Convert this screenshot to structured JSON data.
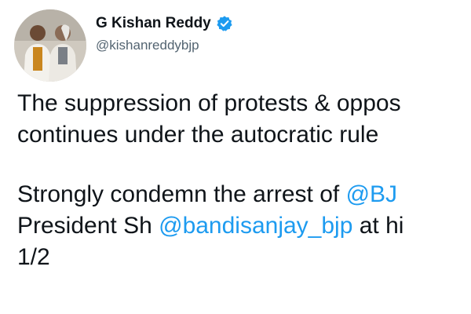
{
  "profile": {
    "display_name": "G Kishan Reddy",
    "handle": "@kishanreddybjp",
    "verified_icon": "verified-badge-icon",
    "verified_color": "#1d9bf0"
  },
  "tweet": {
    "line1": "The suppression of protests & oppos",
    "line2": "continues under the autocratic rule",
    "line3_prefix": "Strongly condemn the arrest of ",
    "line3_mention": "@BJ",
    "line4_prefix": "President Sh ",
    "line4_mention": "@bandisanjay_bjp",
    "line4_suffix": " at hi",
    "line5": "1/2"
  },
  "colors": {
    "link": "#1d9bf0",
    "text": "#0f1419",
    "secondary": "#536471"
  }
}
